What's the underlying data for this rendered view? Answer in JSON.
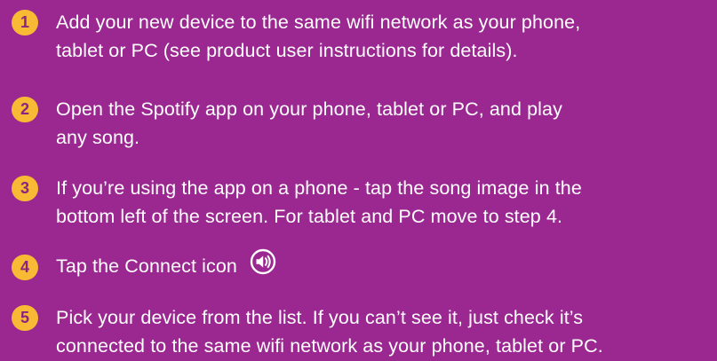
{
  "steps": [
    {
      "number": "1",
      "lines": [
        "Add your new device to the same wifi network as your phone,",
        "tablet or PC (see product user instructions for details)."
      ]
    },
    {
      "number": "2",
      "lines": [
        "Open the Spotify app on your phone, tablet or PC, and play",
        "any song."
      ]
    },
    {
      "number": "3",
      "lines": [
        "If you’re using the app on a phone - tap the song image in the",
        "bottom left of the screen. For tablet and PC move to step 4."
      ]
    },
    {
      "number": "4",
      "lines": [
        "Tap the Connect icon"
      ],
      "icon": "connect-speaker-icon"
    },
    {
      "number": "5",
      "lines": [
        "Pick your device from the list. If you can’t see it, just check it’s",
        "connected to the same wifi network as your phone, tablet or PC."
      ]
    }
  ],
  "colors": {
    "background": "#9b2791",
    "badge": "#f8b934",
    "badge_text": "#8a2481",
    "text": "#ffffff"
  }
}
